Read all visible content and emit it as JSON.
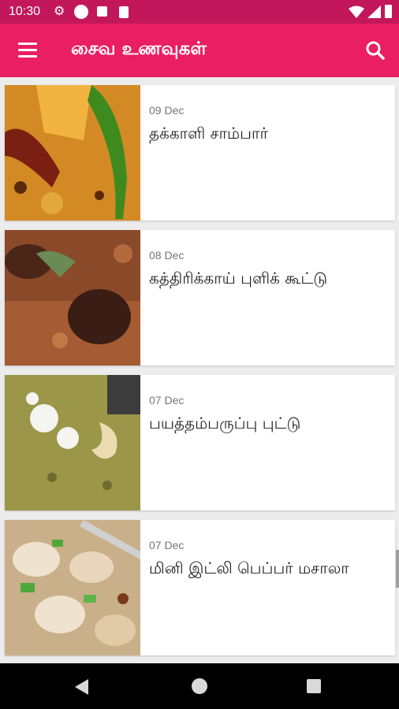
{
  "status_bar": {
    "time": "10:30",
    "icons": [
      "gear-icon",
      "circle-icon",
      "notification-icon",
      "sd-card-icon",
      "wifi-icon",
      "signal-icon",
      "battery-icon"
    ]
  },
  "app_bar": {
    "title": "சைவ உணவுகள்",
    "menu_icon": "hamburger-menu-icon",
    "search_icon": "search-icon",
    "color": "#e91e63",
    "status_color": "#c2185b"
  },
  "recipes": [
    {
      "date": "09 Dec",
      "title": "தக்காளி சாம்பார்",
      "image": "tomato-sambar-photo"
    },
    {
      "date": "08 Dec",
      "title": "கத்திரிக்காய் புளிக் கூட்டு",
      "image": "brinjal-kootu-photo"
    },
    {
      "date": "07 Dec",
      "title": "பயத்தம்பருப்பு புட்டு",
      "image": "moong-dal-puttu-photo"
    },
    {
      "date": "07 Dec",
      "title": "மினி இட்லி பெப்பர் மசாலா",
      "image": "mini-idli-pepper-masala-photo"
    }
  ],
  "nav_bar": {
    "icons": [
      "back-icon",
      "home-icon",
      "recents-icon"
    ]
  }
}
